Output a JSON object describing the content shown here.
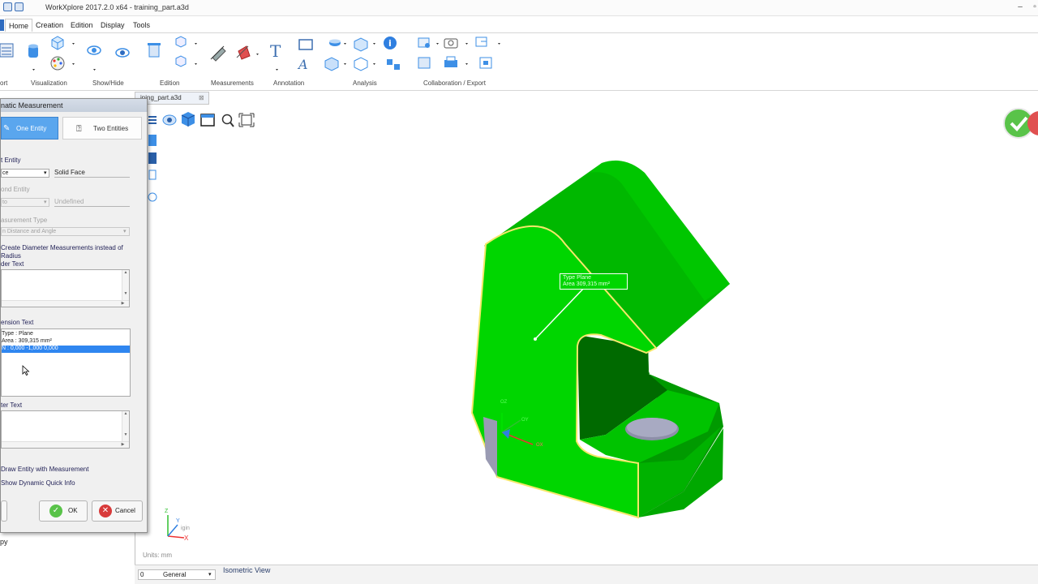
{
  "window": {
    "title": "WorkXplore 2017.2.0 x64 - training_part.a3d"
  },
  "menu": {
    "tabs": [
      "Home",
      "Creation",
      "Edition",
      "Display",
      "Tools"
    ]
  },
  "ribbon": {
    "groups": [
      "ort",
      "Visualization",
      "Show/Hide",
      "Edition",
      "Measurements",
      "Annotation",
      "Analysis",
      "Collaboration / Export"
    ]
  },
  "document_tab": {
    "label": "ining_part.a3d"
  },
  "dialog": {
    "title": "natic Measurement",
    "tab_one": "One Entity",
    "tab_two": "Two Entities",
    "first_entity_label": "t Entity",
    "first_entity_select": "ce",
    "first_entity_value": "Solid Face",
    "second_entity_label": "ond Entity",
    "second_entity_select": "to",
    "second_entity_value": "Undefined",
    "measurement_type_label": "asurement Type",
    "measurement_type_select": "n Distance and Angle",
    "diameter_option_line1": "Create Diameter Measurements instead of",
    "diameter_option_line2": "Radius",
    "header_text_label": "der Text",
    "dimension_text_label": "ension Text",
    "dimension_lines": [
      "Type : Plane",
      "Area : 309,315 mm²",
      "N : 0,000 -1,000 0,000"
    ],
    "footer_text_label": "ter Text",
    "draw_entity_label": "Draw Entity with Measurement",
    "dynamic_info_label": "Show Dynamic Quick Info",
    "ok_label": "OK",
    "cancel_label": "Cancel",
    "below_text": "py"
  },
  "viewport": {
    "annotation_line1": "Type   Plane",
    "annotation_line2": "Area   309,315 mm²",
    "axis_oz": "OZ",
    "axis_oy": "OY",
    "axis_ox": "OX",
    "triad_z": "Z",
    "triad_y": "Y",
    "triad_x": "X",
    "triad_origin": "igin",
    "units": "Units: mm"
  },
  "status": {
    "layer_value": "0",
    "layer_name": "General",
    "view_name": "Isometric View"
  },
  "colors": {
    "part_face": "#00d600",
    "part_dark": "#00a600",
    "selection_edge": "#f5e86a",
    "accent_blue": "#3d8fe6",
    "check_green": "#59c349"
  }
}
